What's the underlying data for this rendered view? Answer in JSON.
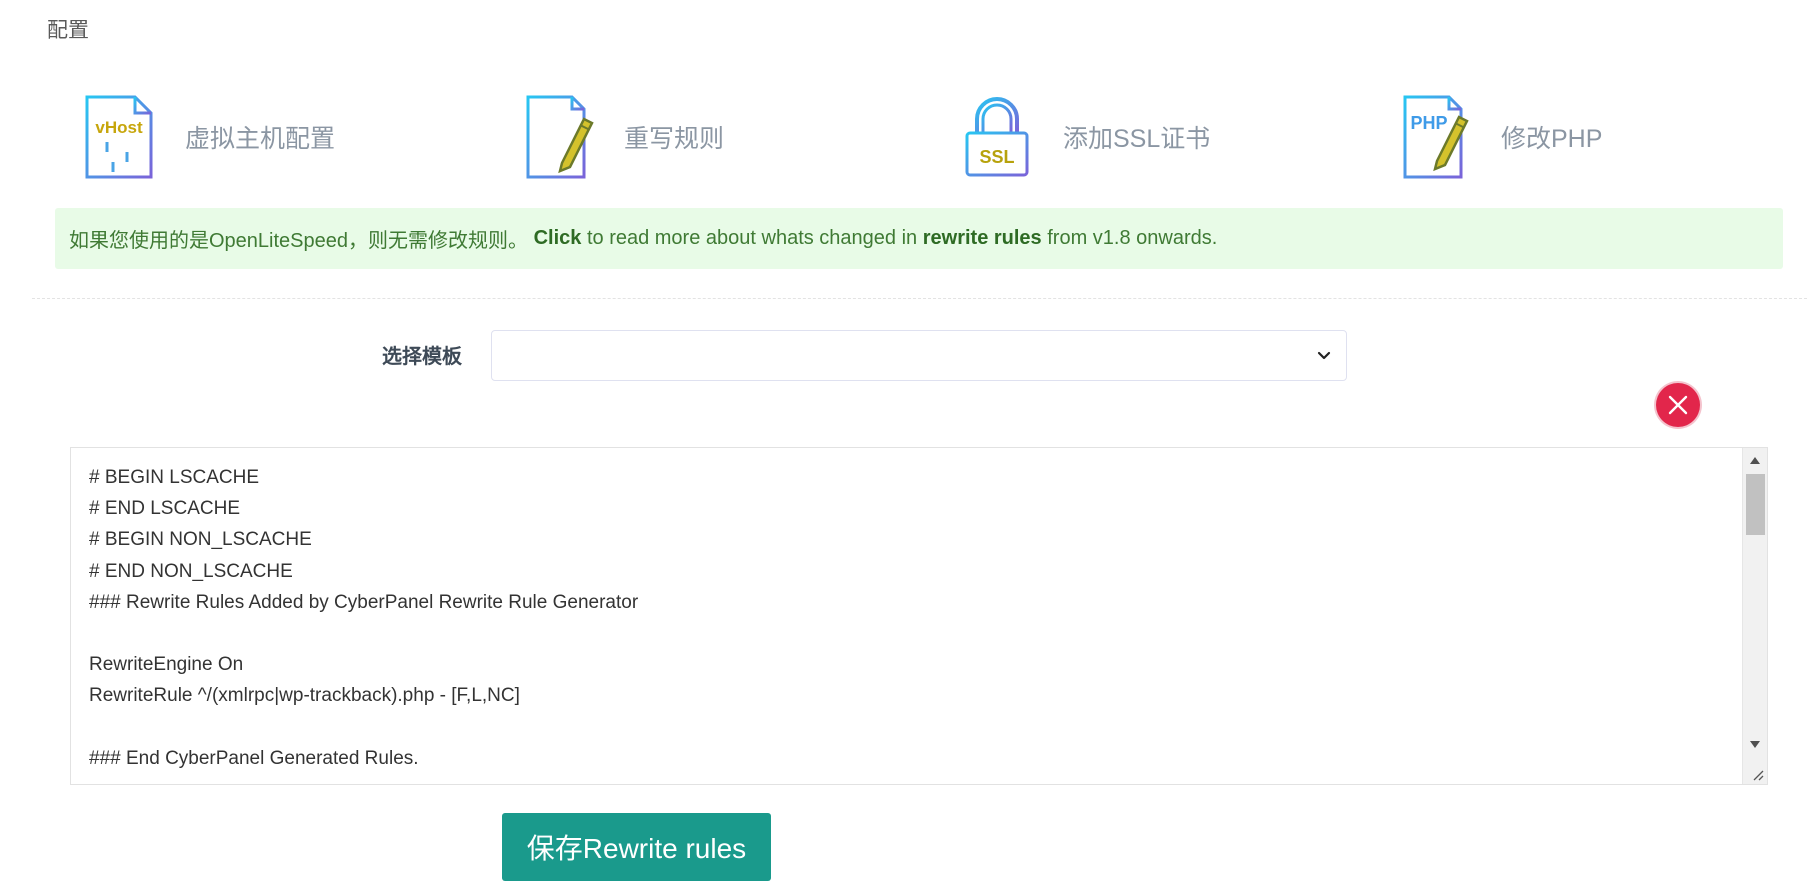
{
  "section": {
    "title": "配置"
  },
  "tiles": [
    {
      "label": "虚拟主机配置",
      "icon": "vhost-doc-icon",
      "icon_text": "vHost"
    },
    {
      "label": "重写规则",
      "icon": "doc-pencil-icon"
    },
    {
      "label": "添加SSL证书",
      "icon": "ssl-lock-icon",
      "icon_text": "SSL"
    },
    {
      "label": "修改PHP",
      "icon": "php-doc-pencil-icon",
      "icon_text": "PHP"
    }
  ],
  "notice": {
    "prefix": "如果您使用的是OpenLiteSpeed，则无需修改规则。",
    "link": "Click",
    "middle": "to read more about whats changed in",
    "bold": "rewrite rules",
    "suffix": "from v1.8 onwards."
  },
  "template": {
    "label": "选择模板",
    "selected": ""
  },
  "editor": {
    "content": "# BEGIN LSCACHE\n# END LSCACHE\n# BEGIN NON_LSCACHE\n# END NON_LSCACHE\n### Rewrite Rules Added by CyberPanel Rewrite Rule Generator\n\nRewriteEngine On\nRewriteRule ^/(xmlrpc|wp-trackback).php - [F,L,NC]\n\n### End CyberPanel Generated Rules."
  },
  "save_button": {
    "label": "保存Rewrite rules"
  },
  "colors": {
    "accent": "#1a9a8c",
    "notice_bg": "#e8fbe7",
    "notice_text": "#3f7a34",
    "close_red": "#e2264b"
  }
}
